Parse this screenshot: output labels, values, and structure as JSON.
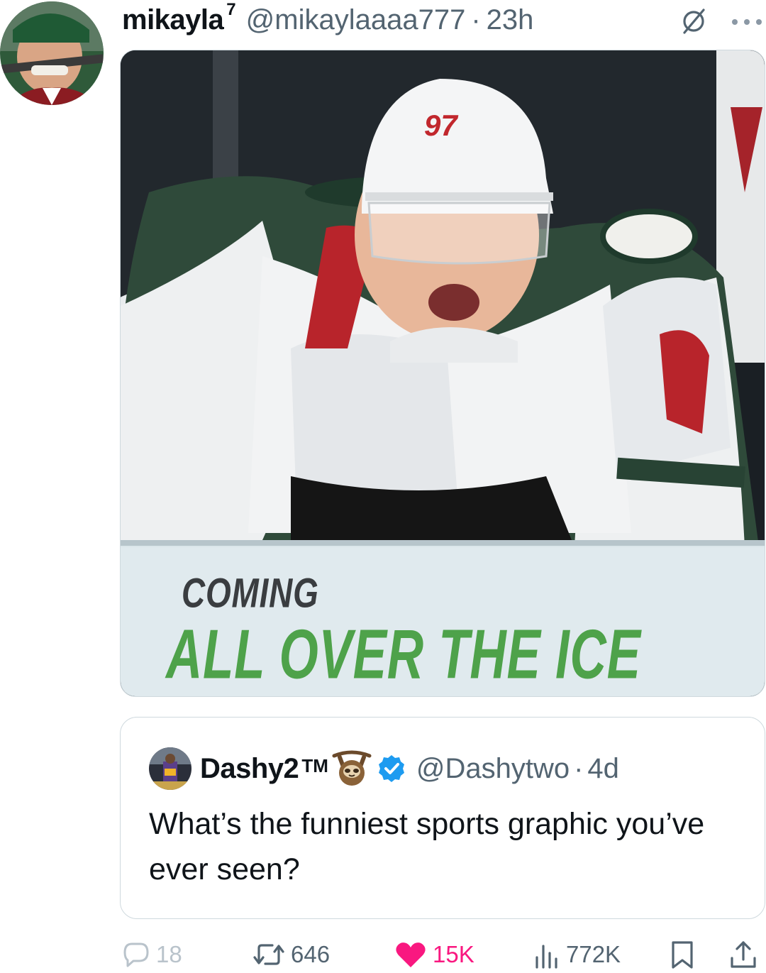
{
  "tweet": {
    "display_name": "mikayla",
    "name_superscript": "7",
    "handle": "@mikaylaaaa777",
    "separator": "·",
    "time": "23h",
    "media": {
      "banner_line_1": "COMING",
      "banner_line_2": "ALL OVER THE ICE"
    }
  },
  "quoted_tweet": {
    "display_name": "Dashy2",
    "name_suffix": "TM",
    "handle": "@Dashytwo",
    "separator": "·",
    "time": "4d",
    "text": "What’s the funniest sports graphic you’ve ever seen?"
  },
  "actions": {
    "replies": "18",
    "retweets": "646",
    "likes": "15K",
    "views": "772K"
  },
  "colors": {
    "secondary_text": "#536471",
    "like_pink": "#f91880",
    "verified_blue": "#1d9bf0",
    "banner_green": "#4ea24a"
  },
  "icons": [
    "grok-icon",
    "more-icon",
    "sloth-icon",
    "verified-icon",
    "reply-icon",
    "retweet-icon",
    "heart-icon",
    "views-icon",
    "bookmark-icon",
    "share-icon"
  ]
}
